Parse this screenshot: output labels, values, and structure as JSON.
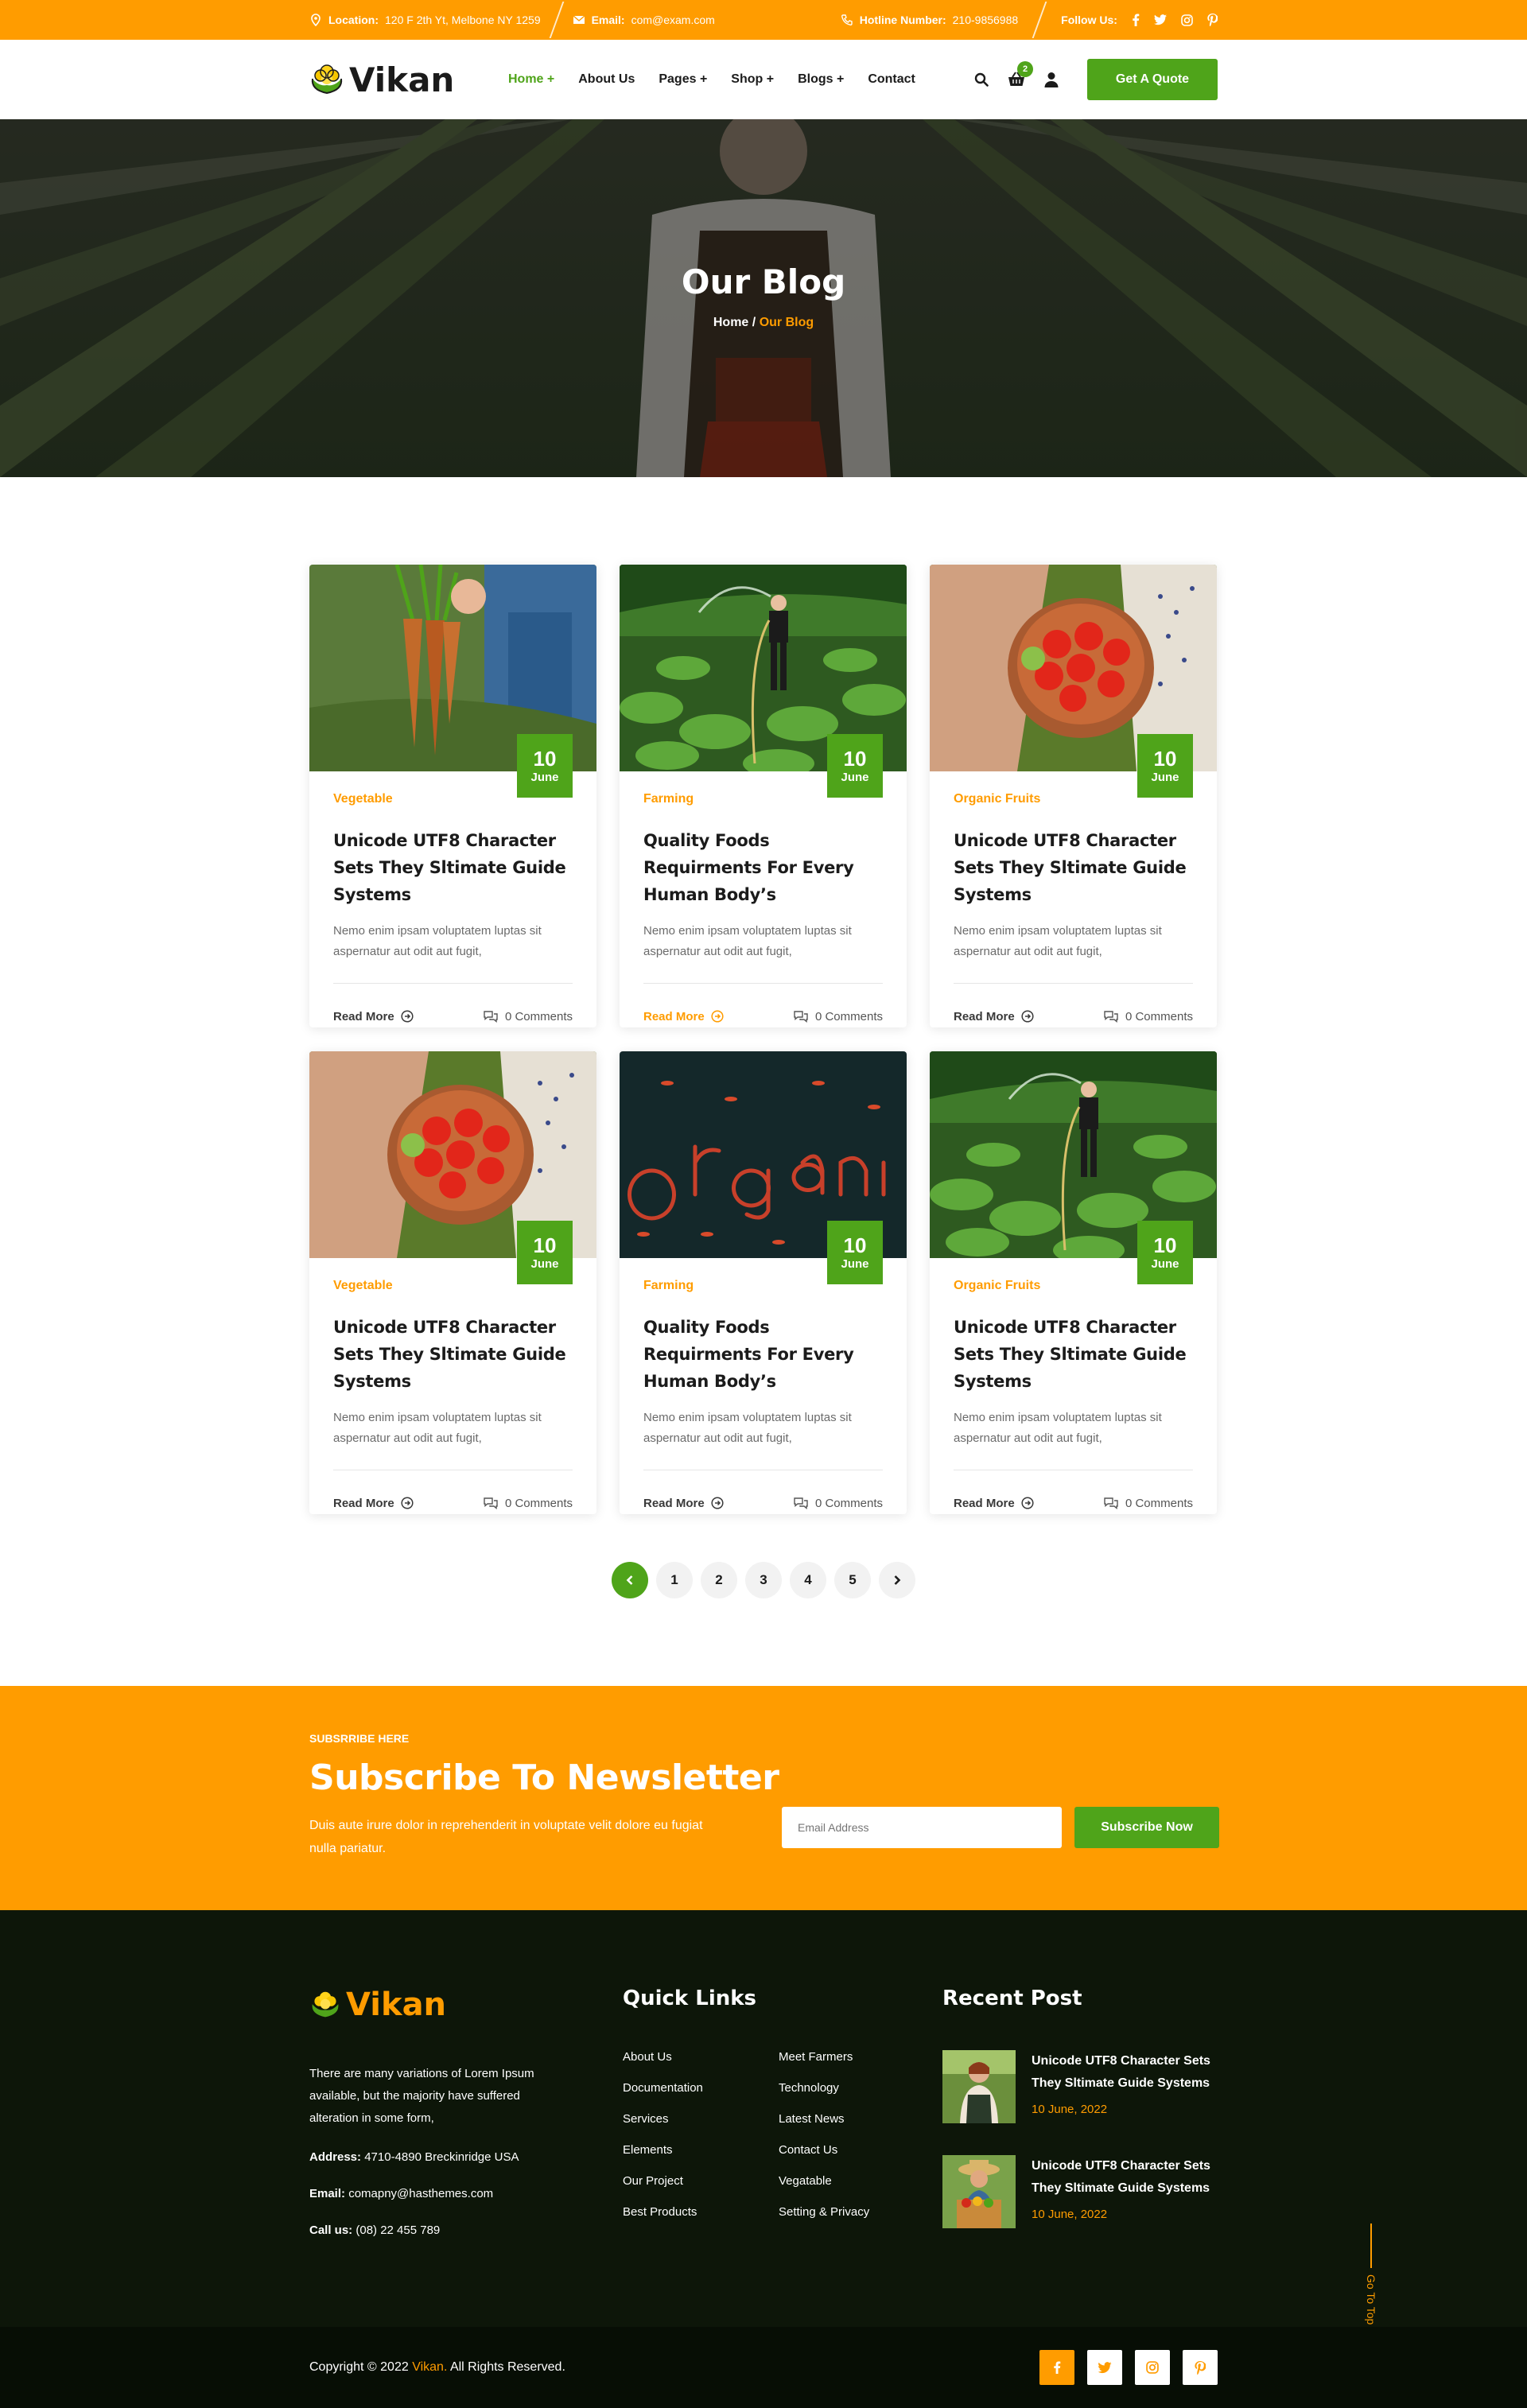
{
  "topbar": {
    "location_label": "Location:",
    "location_value": "120 F 2th Yt, Melbone NY 1259",
    "email_label": "Email:",
    "email_value": "com@exam.com",
    "hotline_label": "Hotline Number:",
    "hotline_value": "210-9856988",
    "follow_label": "Follow Us:"
  },
  "brand": {
    "name": "Vikan",
    "green": "#4fa41a",
    "orange": "#ff9c00"
  },
  "nav": {
    "items": [
      "Home +",
      "About Us",
      "Pages +",
      "Shop +",
      "Blogs +",
      "Contact"
    ],
    "active": "Home +",
    "cart_count": "2",
    "quote_button": "Get A Quote"
  },
  "hero": {
    "title": "Our Blog",
    "crumb_home": "Home",
    "crumb_sep": "/",
    "crumb_current": "Our Blog"
  },
  "posts": [
    {
      "day": "10",
      "month": "June",
      "category": "Vegetable",
      "title": "Unicode UTF8 Character Sets They Sltimate Guide Systems",
      "excerpt": "Nemo enim ipsam voluptatem luptas sit aspernatur aut odit aut fugit,",
      "read_more": "Read More",
      "comments": "0 Comments",
      "image": "carrots"
    },
    {
      "day": "10",
      "month": "June",
      "category": "Farming",
      "title": "Quality Foods Requirments For Every Human Body’s",
      "excerpt": "Nemo enim ipsam voluptatem luptas sit aspernatur aut odit aut fugit,",
      "read_more": "Read More",
      "comments": "0 Comments",
      "image": "watering-field"
    },
    {
      "day": "10",
      "month": "June",
      "category": "Organic Fruits",
      "title": "Unicode UTF8 Character Sets They Sltimate Guide Systems",
      "excerpt": "Nemo enim ipsam voluptatem luptas sit aspernatur aut odit aut fugit,",
      "read_more": "Read More",
      "comments": "0 Comments",
      "image": "tomato-bowl"
    },
    {
      "day": "10",
      "month": "June",
      "category": "Vegetable",
      "title": "Unicode UTF8 Character Sets They Sltimate Guide Systems",
      "excerpt": "Nemo enim ipsam voluptatem luptas sit aspernatur aut odit aut fugit,",
      "read_more": "Read More",
      "comments": "0 Comments",
      "image": "tomato-bowl"
    },
    {
      "day": "10",
      "month": "June",
      "category": "Farming",
      "title": "Quality Foods Requirments For Every Human Body’s",
      "excerpt": "Nemo enim ipsam voluptatem luptas sit aspernatur aut odit aut fugit,",
      "read_more": "Read More",
      "comments": "0 Comments",
      "image": "organic-leaves"
    },
    {
      "day": "10",
      "month": "June",
      "category": "Organic Fruits",
      "title": "Unicode UTF8 Character Sets They Sltimate Guide Systems",
      "excerpt": "Nemo enim ipsam voluptatem luptas sit aspernatur aut odit aut fugit,",
      "read_more": "Read More",
      "comments": "0 Comments",
      "image": "watering-field"
    }
  ],
  "pagination": {
    "pages": [
      "1",
      "2",
      "3",
      "4",
      "5"
    ]
  },
  "newsletter": {
    "kicker": "SUBSRRIBE HERE",
    "title": "Subscribe To Newsletter",
    "text": "Duis aute irure dolor in reprehenderit in voluptate velit dolore eu fugiat nulla pariatur.",
    "placeholder": "Email Address",
    "button": "Subscribe Now"
  },
  "footer": {
    "description": "There are many variations of Lorem Ipsum available, but the majority have suffered alteration in some form,",
    "address_label": "Address:",
    "address_value": "4710-4890 Breckinridge USA",
    "email_label": "Email:",
    "email_value": "comapny@hasthemes.com",
    "call_label": "Call us:",
    "call_value": "(08) 22 455 789",
    "quick_links_title": "Quick Links",
    "quick_links": [
      "About Us",
      "Meet Farmers",
      "Documentation",
      "Technology",
      "Services",
      "Latest News",
      "Elements",
      "Contact Us",
      "Our Project",
      "Vegatable",
      "Best Products",
      "Setting & Privacy"
    ],
    "recent_title": "Recent Post",
    "recent_posts": [
      {
        "title": "Unicode UTF8 Character Sets They Sltimate Guide Systems",
        "date": "10 June, 2022"
      },
      {
        "title": "Unicode UTF8 Character Sets They Sltimate Guide Systems",
        "date": "10 June, 2022"
      }
    ],
    "go_top": "Go To Top",
    "copyright_prefix": "Copyright © 2022",
    "copyright_brand": "Vikan.",
    "copyright_suffix": "All Rights Reserved."
  }
}
